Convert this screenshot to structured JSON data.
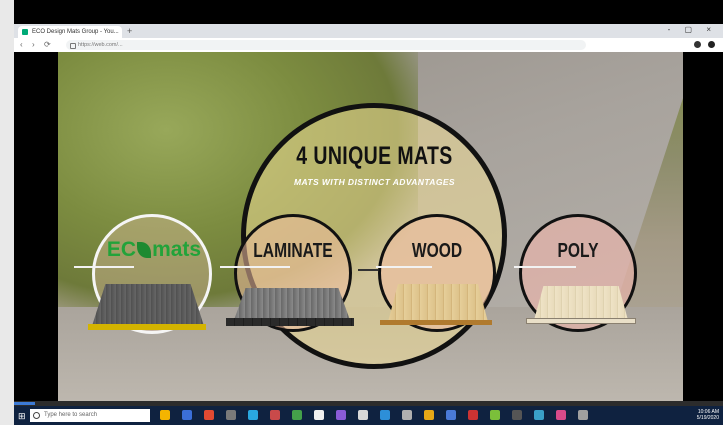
{
  "browser": {
    "tab_title": "ECO Design Mats Group - You...",
    "new_tab": "+",
    "window_controls": "- ▢ ×",
    "url": "https://web.com/...",
    "nav_back": "‹",
    "nav_forward": "›",
    "nav_reload": "⟳"
  },
  "slide": {
    "title": "4 UNIQUE MATS",
    "subtitle": "MATS WITH DISTINCT ADVANTAGES",
    "mats": [
      {
        "label": "ECO mats",
        "brand_prefix": "EC",
        "brand_suffix": "mats",
        "color": "#22a33a"
      },
      {
        "label": "LAMINATE"
      },
      {
        "label": "WOOD"
      },
      {
        "label": "POLY"
      }
    ]
  },
  "video": {
    "progress_fraction": 0.03
  },
  "taskbar": {
    "search_placeholder": "Type here to search",
    "start_icon": "windows-logo",
    "tray_time": "10:06 AM",
    "tray_date": "5/19/2020",
    "app_icon_colors": [
      "#f4b400",
      "#3b6fd8",
      "#e24a32",
      "#7a7a7a",
      "#2aa8e0",
      "#c94a4a",
      "#44a04a",
      "#f0f0f0",
      "#8a5bd8",
      "#d8d8d8",
      "#2d8fd8",
      "#b0b0b0",
      "#e6a817",
      "#4a7ad8",
      "#c33",
      "#7bbf3a",
      "#555",
      "#3aa0c8",
      "#d84a8a",
      "#a0a0a0"
    ]
  }
}
